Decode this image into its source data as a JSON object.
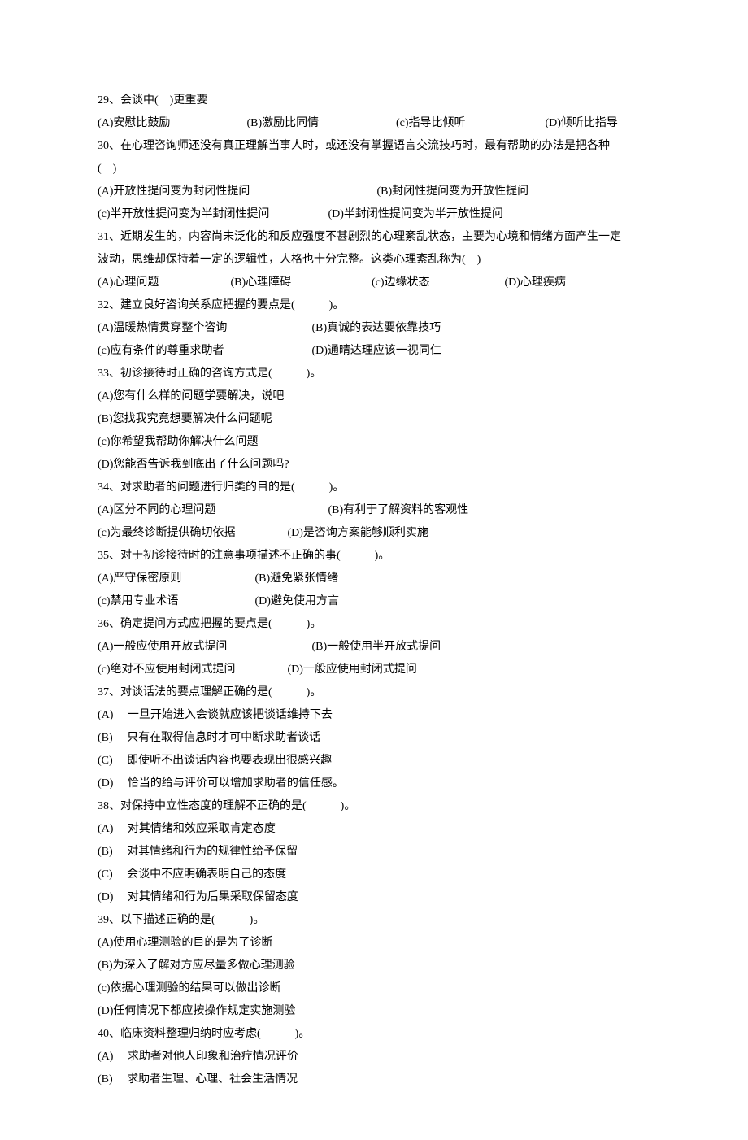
{
  "q29": {
    "stem": "29、会谈中(　)更重要",
    "a": "(A)安慰比鼓励",
    "b": "(B)激励比同情",
    "c": "(c)指导比倾听",
    "d": "(D)倾听比指导"
  },
  "q30": {
    "stem1": "30、在心理咨询师还没有真正理解当事人时，或还没有掌握语言交流技巧时，最有帮助的办法是把各种",
    "stem2": "(　)",
    "a": "(A)开放性提问变为封闭性提问",
    "b": "(B)封闭性提问变为开放性提问",
    "c": "(c)半开放性提问变为半封闭性提问",
    "d": "(D)半封闭性提问变为半开放性提问"
  },
  "q31": {
    "stem1": "31、近期发生的，内容尚未泛化的和反应强度不甚剧烈的心理紊乱状态，主要为心境和情绪方面产生一定",
    "stem2": "波动，思维却保持着一定的逻辑性，人格也十分完整。这类心理紊乱称为(　)",
    "a": "(A)心理问题",
    "b": "(B)心理障碍",
    "c": "(c)边缘状态",
    "d": "(D)心理疾病"
  },
  "q32": {
    "stem": "32、建立良好咨询关系应把握的要点是(　　　)。",
    "a": "(A)温暖热情贯穿整个咨询",
    "b": "(B)真诚的表达要依靠技巧",
    "c": "(c)应有条件的尊重求助者",
    "d": "(D)通晴达理应该一视同仁"
  },
  "q33": {
    "stem": "33、初诊接待时正确的咨询方式是(　　　)。",
    "a": "(A)您有什么样的问题学要解决，说吧",
    "b": "(B)您找我究竟想要解决什么问题呢",
    "c": "(c)你希望我帮助你解决什么问题",
    "d": "(D)您能否告诉我到底出了什么问题吗?"
  },
  "q34": {
    "stem": "34、对求助者的问题进行归类的目的是(　　　)。",
    "a": "(A)区分不同的心理问题",
    "b": "(B)有利于了解资料的客观性",
    "c": "(c)为最终诊断提供确切依据",
    "d": "(D)是咨询方案能够顺利实施"
  },
  "q35": {
    "stem": "35、对于初诊接待时的注意事项描述不正确的事(　　　)。",
    "a": "(A)严守保密原则",
    "b": "(B)避免紧张情绪",
    "c": "(c)禁用专业术语",
    "d": "(D)避免使用方言"
  },
  "q36": {
    "stem": "36、确定提问方式应把握的要点是(　　　)。",
    "a": "(A)一般应使用开放式提问",
    "b": "(B)一般使用半开放式提问",
    "c": "(c)绝对不应使用封闭式提问",
    "d": "(D)一般应使用封闭式提问"
  },
  "q37": {
    "stem": "37、对谈话法的要点理解正确的是(　　　)。",
    "a": "(A) 　一旦开始进入会谈就应该把谈话维持下去",
    "b": "(B) 　只有在取得信息时才可中断求助者谈话",
    "c": "(C) 　即使听不出谈话内容也要表现出很感兴趣",
    "d": "(D) 　恰当的给与评价可以增加求助者的信任感。"
  },
  "q38": {
    "stem": "38、对保持中立性态度的理解不正确的是(　　　)。",
    "a": "(A) 　对其情绪和效应采取肯定态度",
    "b": "(B) 　对其情绪和行为的规律性给予保留",
    "c": "(C) 　会谈中不应明确表明自己的态度",
    "d": "(D) 　对其情绪和行为后果采取保留态度"
  },
  "q39": {
    "stem": "39、以下描述正确的是(　　　)。",
    "a": "(A)使用心理测验的目的是为了诊断",
    "b": "(B)为深入了解对方应尽量多做心理测验",
    "c": "(c)依据心理测验的结果可以做出诊断",
    "d": "(D)任何情况下都应按操作规定实施测验"
  },
  "q40": {
    "stem": "40、临床资料整理归纳时应考虑(　　　)。",
    "a": "(A) 　求助者对他人印象和治疗情况评价",
    "b": "(B) 　求助者生理、心理、社会生活情况"
  }
}
